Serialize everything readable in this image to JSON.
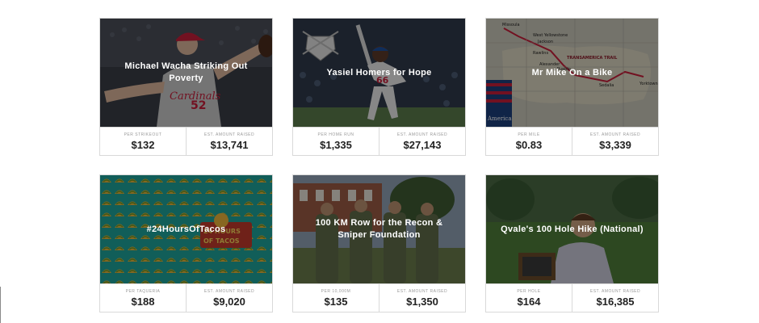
{
  "cards": [
    {
      "title": "Michael Wacha Striking Out Poverty",
      "rate_label": "PER STRIKEOUT",
      "rate_value": "$132",
      "raised_label": "EST. AMOUNT RAISED",
      "raised_value": "$13,741"
    },
    {
      "title": "Yasiel Homers for Hope",
      "rate_label": "PER HOME RUN",
      "rate_value": "$1,335",
      "raised_label": "EST. AMOUNT RAISED",
      "raised_value": "$27,143"
    },
    {
      "title": "Mr Mike On a Bike",
      "rate_label": "PER MILE",
      "rate_value": "$0.83",
      "raised_label": "EST. AMOUNT RAISED",
      "raised_value": "$3,339"
    },
    {
      "title": "#24HoursOfTacos",
      "rate_label": "PER TAQUERIA",
      "rate_value": "$188",
      "raised_label": "EST. AMOUNT RAISED",
      "raised_value": "$9,020"
    },
    {
      "title": "100 KM Row for the Recon & Sniper Foundation",
      "rate_label": "PER 10,000M",
      "rate_value": "$135",
      "raised_label": "EST. AMOUNT RAISED",
      "raised_value": "$1,350"
    },
    {
      "title": "Qvale's 100 Hole Hike (National)",
      "rate_label": "PER HOLE",
      "rate_value": "$164",
      "raised_label": "EST. AMOUNT RAISED",
      "raised_value": "$16,385"
    }
  ],
  "artwork": {
    "jersey_text": "Cardinals",
    "jersey_number": "52",
    "player_number": "66",
    "map_labels": [
      "Missoula",
      "West Yellowstone",
      "Jackson",
      "Rawlins",
      "Alexander",
      "Pueblo",
      "Sedalia",
      "Yorktown",
      "TRANSAMERICA TRAIL",
      "America"
    ],
    "taco_badge_line1": "24 HOURS",
    "taco_badge_line2": "OF TACOS"
  },
  "colors": {
    "cardinals_red": "#c41e3a",
    "dodgers_blue": "#1d4f9a",
    "taco_teal": "#1ea39a",
    "grass_green": "#4f7d3a",
    "camo": "#5f6b49"
  },
  "icons": {
    "photo_1": "baseball-pitcher-photo",
    "photo_2": "baseball-batter-photo",
    "photo_3": "route-map-photo",
    "photo_4": "taco-pattern-photo",
    "photo_5": "soldiers-photo",
    "photo_6": "golfer-photo"
  }
}
